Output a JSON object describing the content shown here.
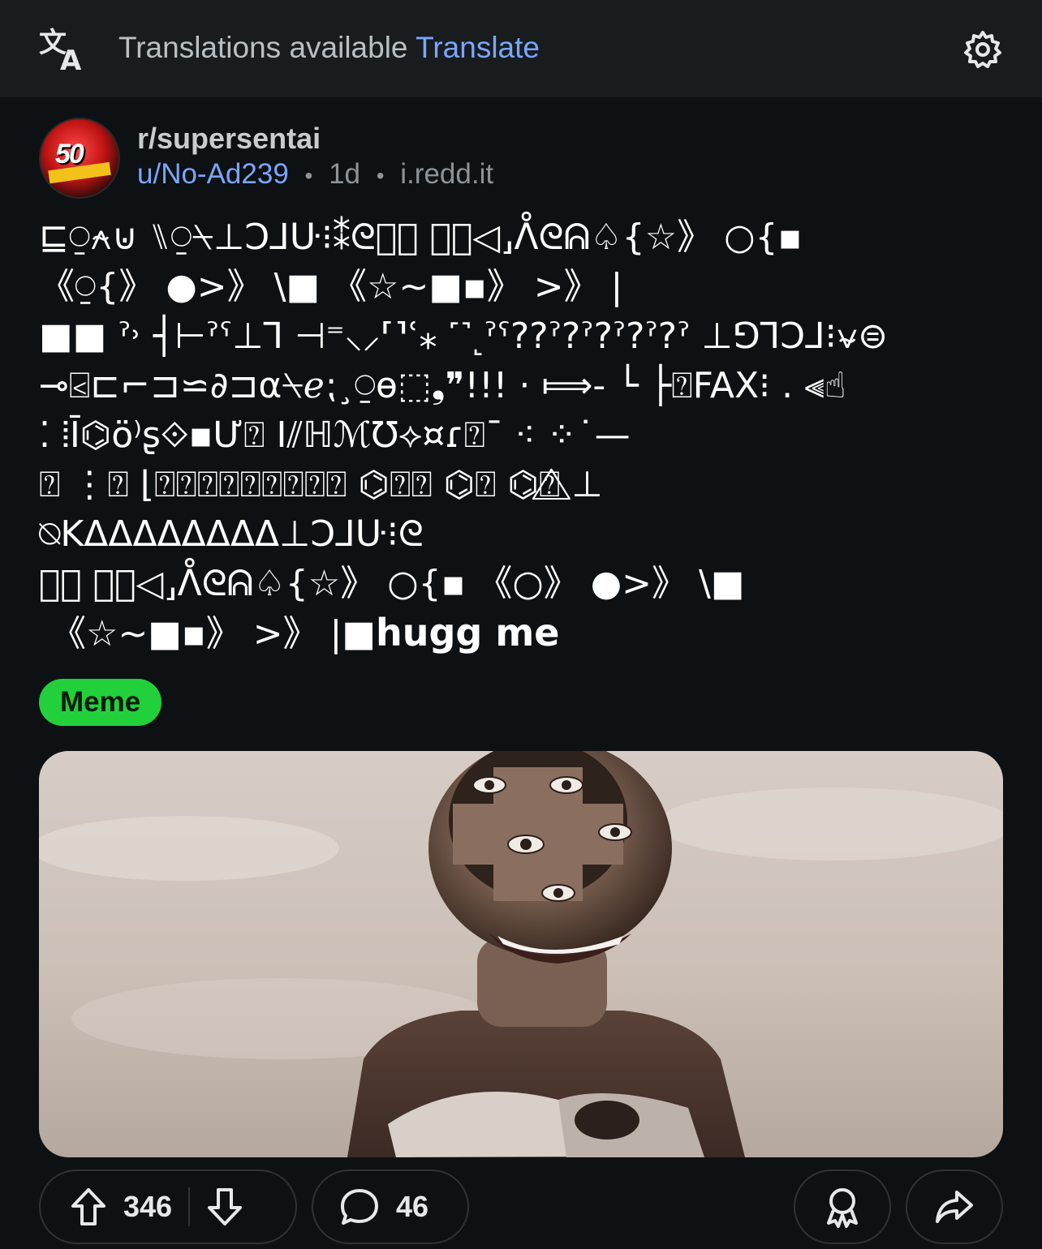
{
  "translation_bar": {
    "icon": "translate-icon",
    "text": "Translations available",
    "link": "Translate",
    "settings_icon": "gear-icon"
  },
  "post": {
    "subreddit": "r/supersentai",
    "author": "u/No-Ad239",
    "age": "1d",
    "domain": "i.redd.it",
    "separator": "•",
    "body_glyphs": "⊑⍜⍲⊍ ⑊⍜⍀⊥Ͻ⅃ᑘ⁝⁑ᘓ༄⃝ ⍰⃠◁⸥ᐰᘓᕱ♤{☆》 ○{▪\n《⍜{》 ●>》 \\■ 《☆~■▪》 >》 |\n■■ ˀ˒ ┤⊢ˀˁ⊥⅂ ⊣⁼⸜⸝⸢⸣ʿ⁎ ˹˺˻ˀˁ??ˀ?ˀ?ˀ?ˀ?ˀ ⊥⅁⅂Ͻ⅃⁝⍱⊜\n⊸⍃⊏⌐⊐⋍∂⊐α⍀ℯ⁏¸⍜ɵ⬚❟❞!!! · ⟾- └ ├⍰FAX⁝ . ⫷☝\n⁚ ⦙Ī⌬ö⁾ʂ⟐▪Ư⍰ I⫽ℍℳ℧⟡¤ɾ⍰¯ ⁖ ⁘˙—\n⍰ ⋮⍰ ⌊⍰⍰⍰⍰⍰⍰⍰⍰⍰ ⌬⍰⍰ ⌬⍰ ⌬⍰⃤ ⊥\n⍉KΔΔΔΔΔΔΔΔ⊥Ͻ⅃ᑘ⁝ᘓ\n༄⃝ ⍰⃠◁⸥ᐰᘓᕱ♤{☆》 ○{▪ 《○》 ●>》 \\■\n 《☆~■▪》 >》 |■",
    "body_tail": "hugg me",
    "flair": "Meme",
    "upvotes": "346",
    "comments": "46",
    "icons": {
      "upvote": "upvote-arrow-icon",
      "downvote": "downvote-arrow-icon",
      "comment": "comment-bubble-icon",
      "award": "award-icon",
      "share": "share-arrow-icon"
    },
    "colors": {
      "link": "#7aa6ff",
      "flair_bg": "#22d03c",
      "background": "#0e1113"
    }
  }
}
